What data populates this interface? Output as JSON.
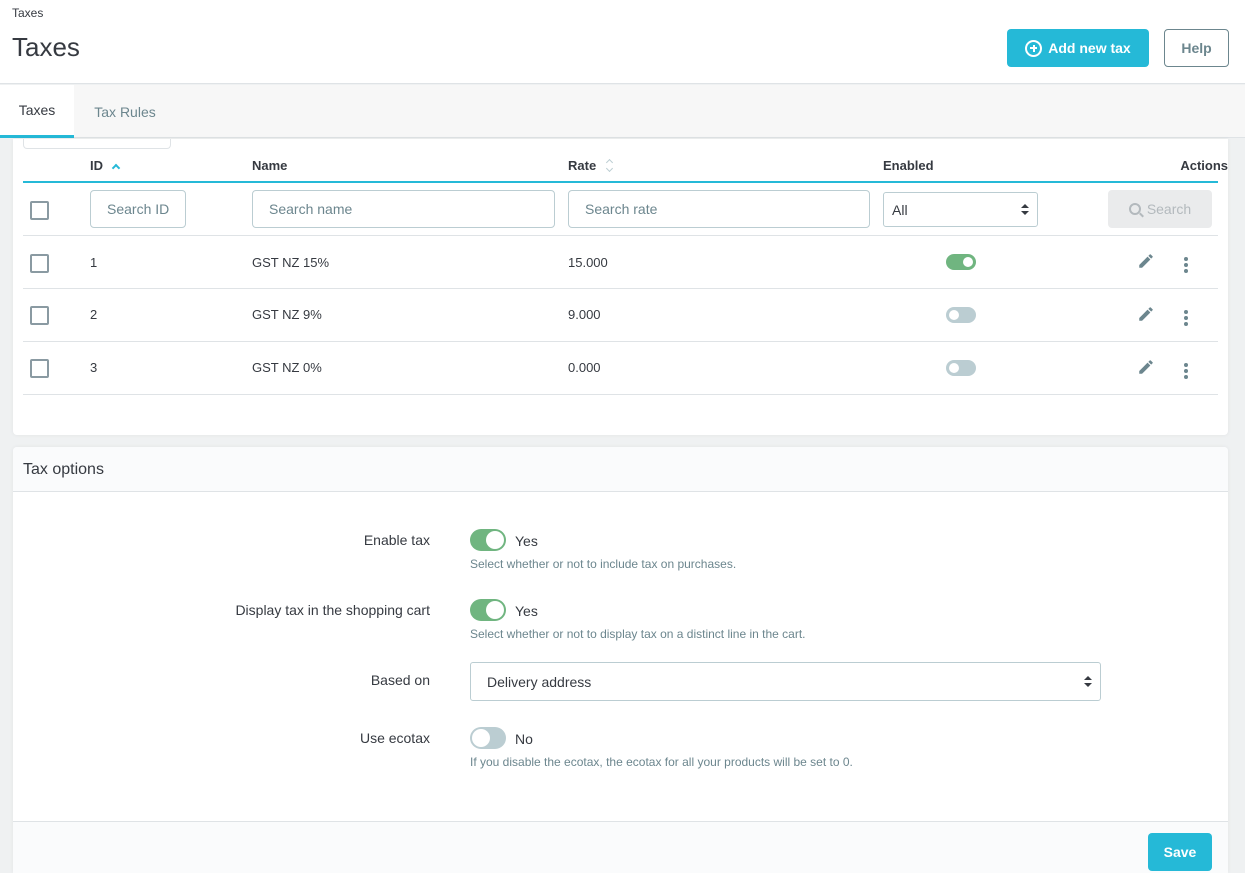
{
  "header": {
    "breadcrumb": "Taxes",
    "title": "Taxes",
    "add_button": "Add new tax",
    "help_button": "Help"
  },
  "tabs": [
    {
      "label": "Taxes",
      "active": true
    },
    {
      "label": "Tax Rules",
      "active": false
    }
  ],
  "table": {
    "columns": {
      "id": "ID",
      "name": "Name",
      "rate": "Rate",
      "enabled": "Enabled",
      "actions": "Actions"
    },
    "filters": {
      "id_placeholder": "Search ID",
      "name_placeholder": "Search name",
      "rate_placeholder": "Search rate",
      "enabled_value": "All",
      "search_button": "Search"
    },
    "rows": [
      {
        "id": "1",
        "name": "GST NZ 15%",
        "rate": "15.000",
        "enabled": true
      },
      {
        "id": "2",
        "name": "GST NZ 9%",
        "rate": "9.000",
        "enabled": false
      },
      {
        "id": "3",
        "name": "GST NZ 0%",
        "rate": "0.000",
        "enabled": false
      }
    ]
  },
  "options": {
    "title": "Tax options",
    "enable_tax": {
      "label": "Enable tax",
      "state": "Yes",
      "on": true,
      "help": "Select whether or not to include tax on purchases."
    },
    "display_tax_cart": {
      "label": "Display tax in the shopping cart",
      "state": "Yes",
      "on": true,
      "help": "Select whether or not to display tax on a distinct line in the cart."
    },
    "based_on": {
      "label": "Based on",
      "value": "Delivery address"
    },
    "use_ecotax": {
      "label": "Use ecotax",
      "state": "No",
      "on": false,
      "help": "If you disable the ecotax, the ecotax for all your products will be set to 0."
    },
    "save_button": "Save"
  },
  "colors": {
    "accent": "#25b9d7",
    "toggle_on": "#70b580",
    "toggle_off": "#bbcdd2"
  },
  "icons": [
    "plus-circle-icon",
    "search-icon",
    "pencil-icon",
    "kebab-menu-icon",
    "sort-asc-icon",
    "sort-icon",
    "select-caret-icon"
  ]
}
